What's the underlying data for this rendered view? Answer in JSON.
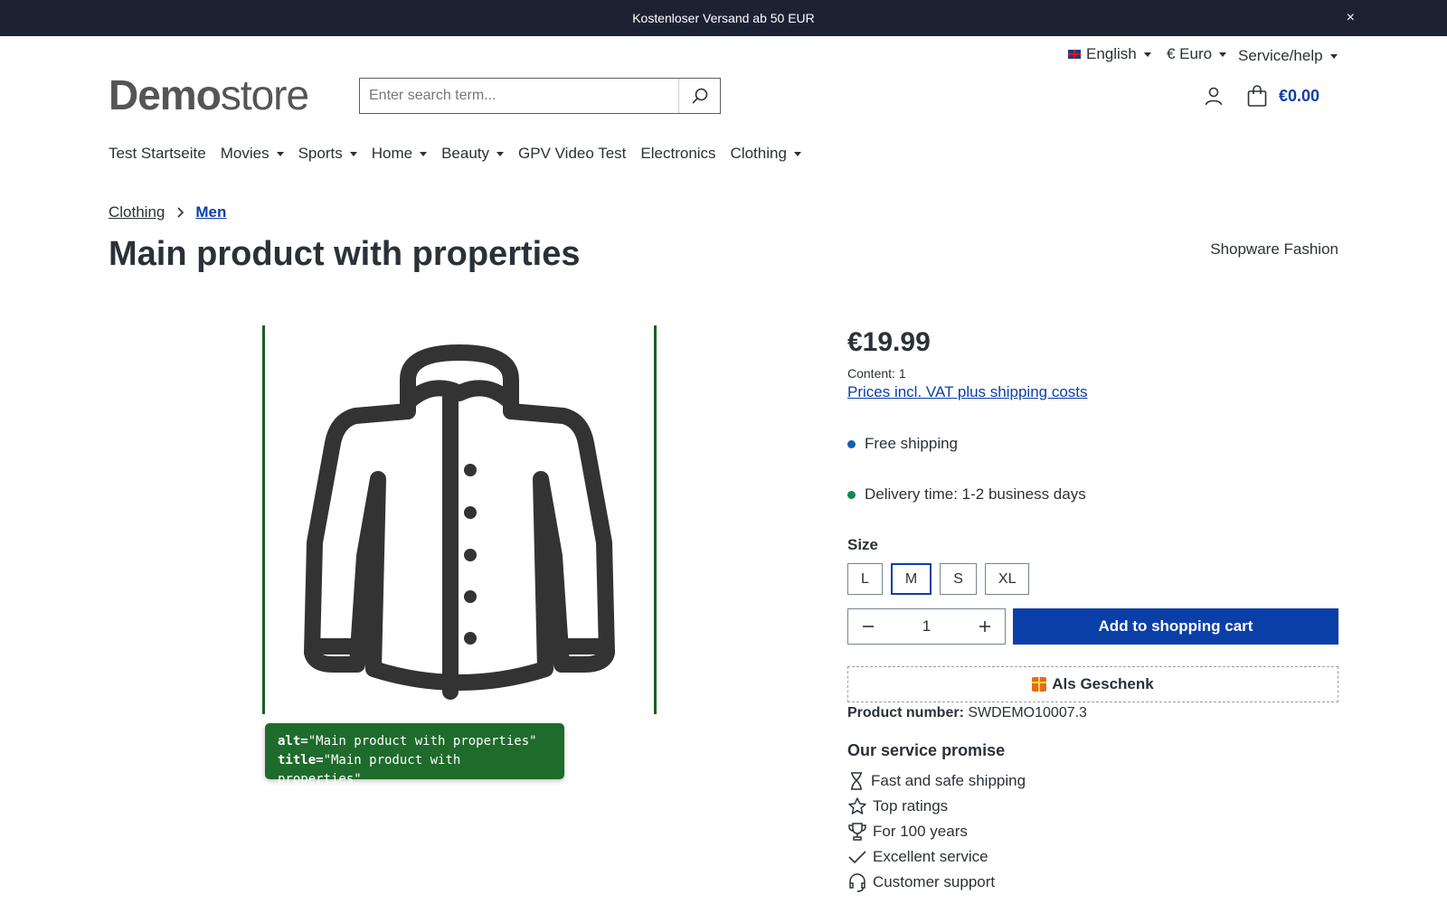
{
  "announcement": {
    "text": "Kostenloser Versand ab 50 EUR",
    "close": "×"
  },
  "utility": {
    "language": "English",
    "currency": "€ Euro",
    "service": "Service/help"
  },
  "logo": {
    "bold": "Demo",
    "light": "store"
  },
  "search": {
    "placeholder": "Enter search term..."
  },
  "cart": {
    "total": "€0.00"
  },
  "nav": [
    "Test Startseite",
    "Movies",
    "Sports",
    "Home",
    "Beauty",
    "GPV Video Test",
    "Electronics",
    "Clothing"
  ],
  "breadcrumb": {
    "parent": "Clothing",
    "current": "Men"
  },
  "product": {
    "title": "Main product with properties",
    "manufacturer": "Shopware Fashion",
    "price": "€19.99",
    "content": "Content: 1",
    "vat_link": "Prices incl. VAT plus shipping costs",
    "shipping": "Free shipping",
    "delivery": "Delivery time: 1-2 business days",
    "size_label": "Size",
    "sizes": [
      "L",
      "M",
      "S",
      "XL"
    ],
    "selected_size": "M",
    "quantity": "1",
    "add_to_cart": "Add to shopping cart",
    "gift": "Als Geschenk",
    "product_number_label": "Product number:",
    "product_number": "SWDEMO10007.3"
  },
  "image_tooltip": {
    "alt_key": "alt=",
    "alt_value": "\"Main product with properties\"",
    "title_key": "title=",
    "title_value": "\"Main product with properties\""
  },
  "service_promise": {
    "heading": "Our service promise",
    "items": [
      "Fast and safe shipping",
      "Top ratings",
      "For 100 years",
      "Excellent service",
      "Customer support"
    ]
  },
  "colors": {
    "primary": "#0b3fa8",
    "topbar": "#1c2232",
    "tooltip": "#1f6b2c"
  }
}
